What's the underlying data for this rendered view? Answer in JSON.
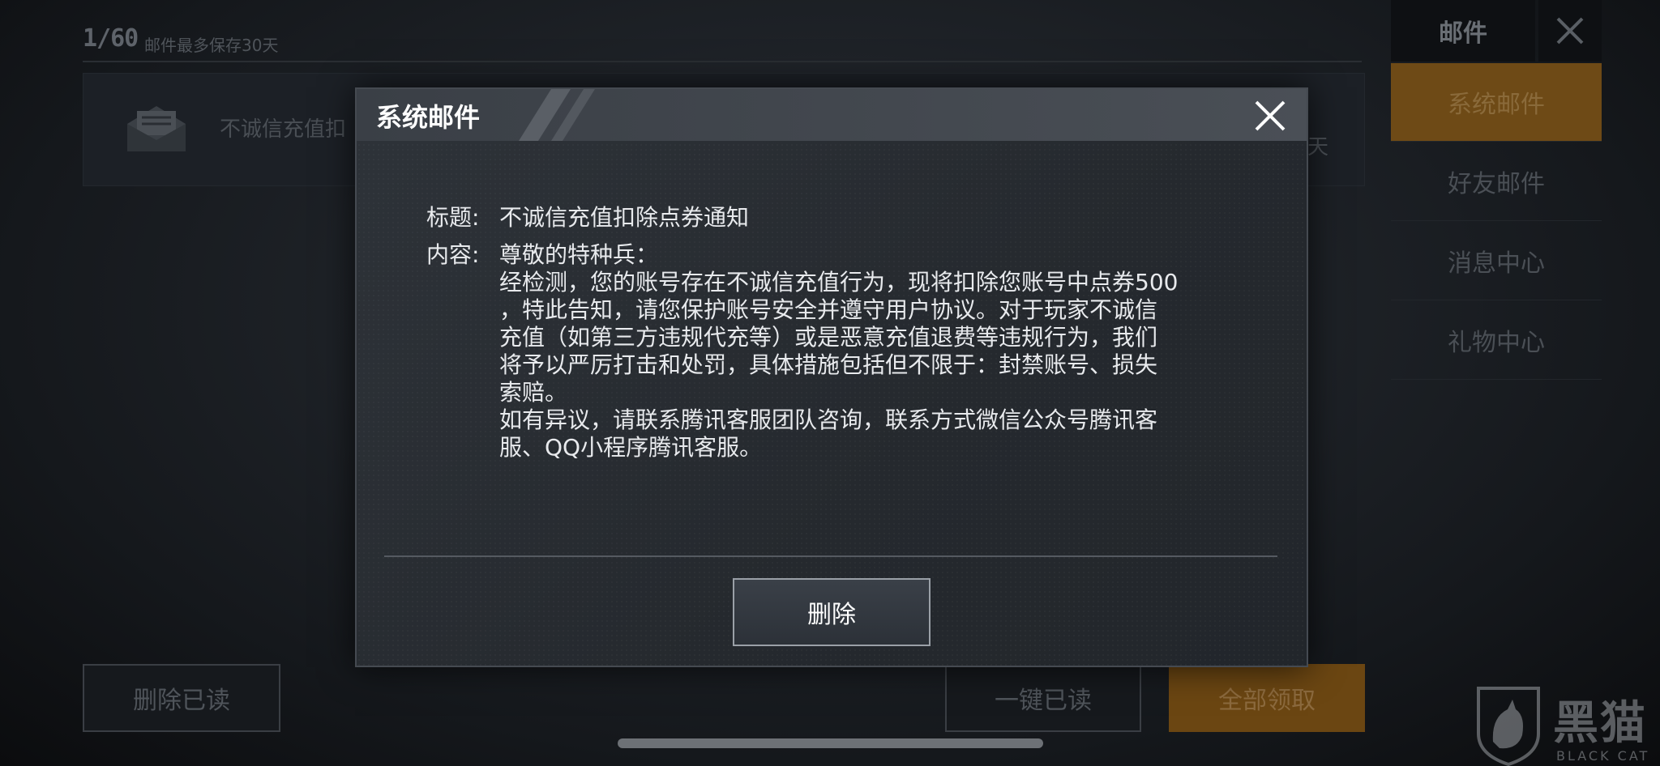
{
  "background": {
    "count": "1/60",
    "count_note": "邮件最多保存30天",
    "mail_item": {
      "title": "不诚信充值扣",
      "days": "天"
    },
    "sidebar": {
      "header": "邮件",
      "items": [
        {
          "label": "系统邮件",
          "active": true
        },
        {
          "label": "好友邮件",
          "active": false
        },
        {
          "label": "消息中心",
          "active": false
        },
        {
          "label": "礼物中心",
          "active": false
        }
      ]
    },
    "buttons": {
      "delete_read": "删除已读",
      "mark_all_read": "一键已读",
      "claim_all": "全部领取"
    },
    "colors": {
      "accent_orange": "#6b4612"
    }
  },
  "modal": {
    "title": "系统邮件",
    "subject_label": "标题:",
    "subject": "不诚信充值扣除点券通知",
    "content_label": "内容:",
    "content": "尊敬的特种兵：\n经检测，您的账号存在不诚信充值行为，现将扣除您账号中点券500\n，特此告知，请您保护账号安全并遵守用户协议。对于玩家不诚信\n充值（如第三方违规代充等）或是恶意充值退费等违规行为，我们\n将予以严厉打击和处罚，具体措施包括但不限于：封禁账号、损失\n索赔。\n如有异议，请联系腾讯客服团队咨询，联系方式微信公众号腾讯客\n服、QQ小程序腾讯客服。",
    "delete_label": "删除"
  },
  "watermark": {
    "text": "黑猫",
    "sub": "BLACK CAT"
  }
}
